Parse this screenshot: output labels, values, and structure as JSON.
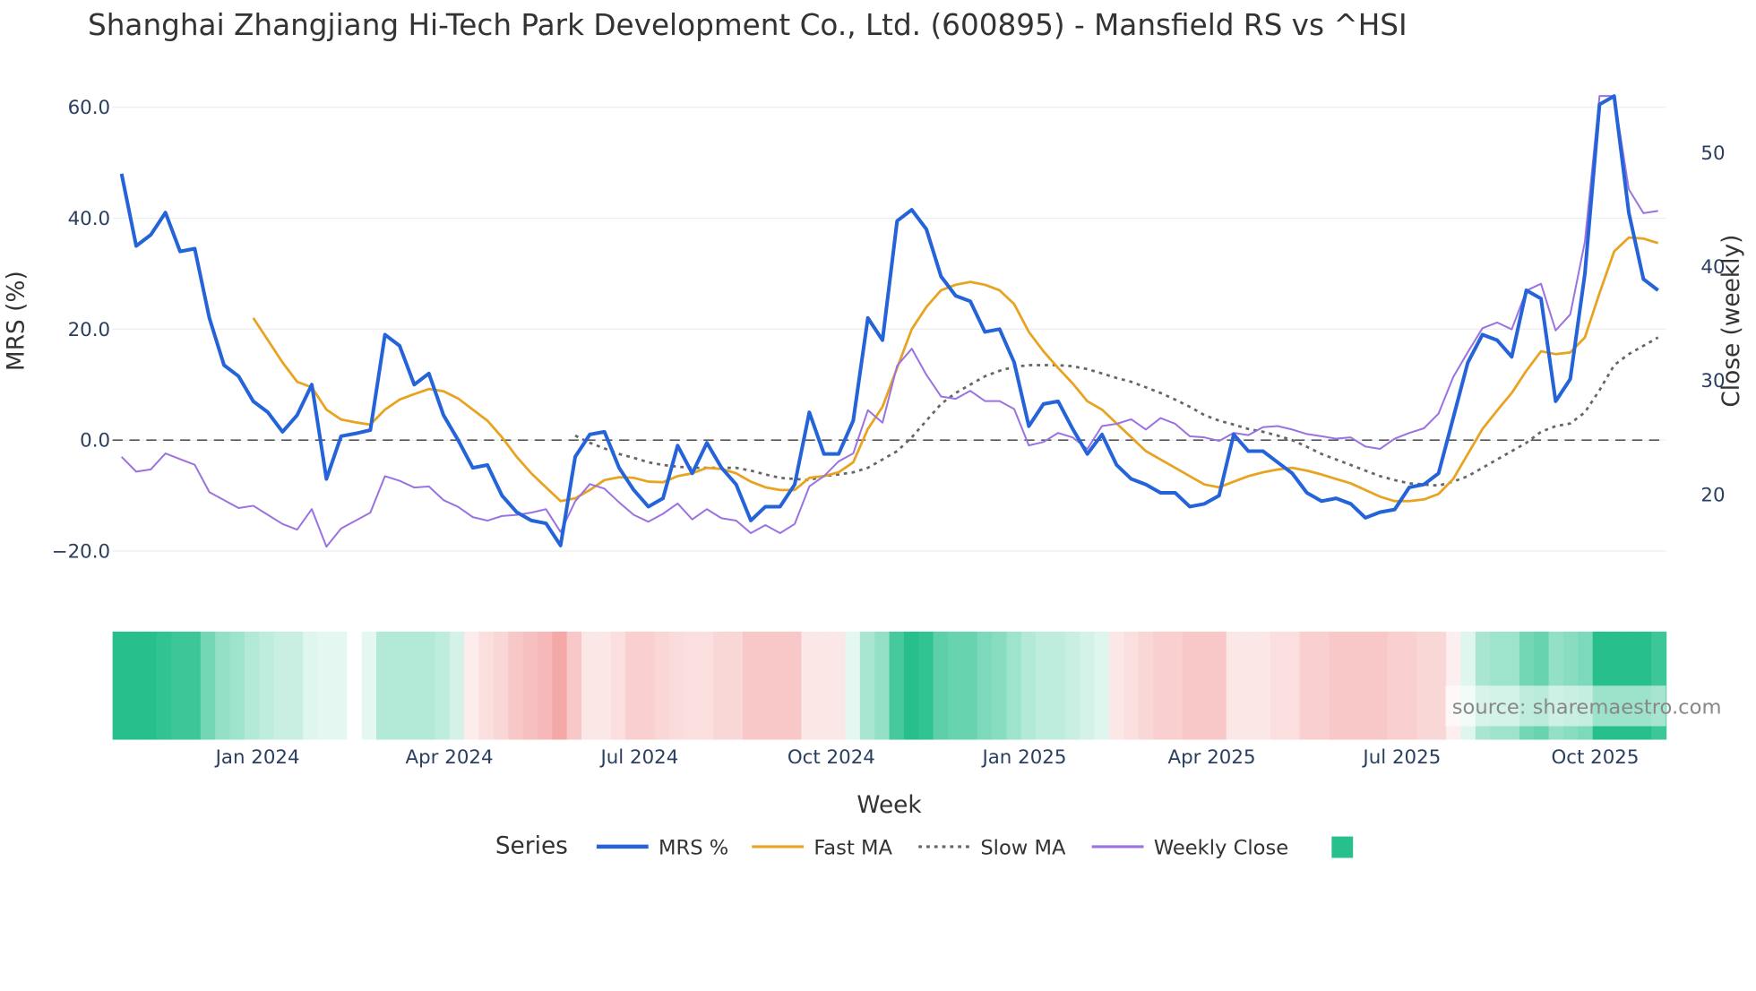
{
  "chart_data": {
    "type": "line",
    "title": "Shanghai Zhangjiang Hi-Tech Park Development Co., Ltd. (600895) - Mansfield RS vs ^HSI",
    "xlabel": "Week",
    "ylabel": "MRS (%)",
    "y2label": "Close (weekly)",
    "ylim": [
      -26.2,
      65.1
    ],
    "y2lim": [
      12.0,
      56.5
    ],
    "grid": true,
    "zero_line": 0,
    "yticks": [
      {
        "v": 60,
        "label": "60.0"
      },
      {
        "v": 40,
        "label": "40.0"
      },
      {
        "v": 20,
        "label": "20.0"
      },
      {
        "v": 0,
        "label": "0.0"
      },
      {
        "v": -20,
        "label": "−20.0"
      }
    ],
    "y2ticks": [
      {
        "v": 50,
        "label": "50"
      },
      {
        "v": 40,
        "label": "40"
      },
      {
        "v": 30,
        "label": "30"
      },
      {
        "v": 20,
        "label": "20"
      }
    ],
    "xticks": [
      {
        "week": 9.3,
        "label": "Jan 2024"
      },
      {
        "week": 22.4,
        "label": "Apr 2024"
      },
      {
        "week": 35.4,
        "label": "Jul 2024"
      },
      {
        "week": 48.5,
        "label": "Oct 2024"
      },
      {
        "week": 61.7,
        "label": "Jan 2025"
      },
      {
        "week": 74.5,
        "label": "Apr 2025"
      },
      {
        "week": 87.5,
        "label": "Jul 2025"
      },
      {
        "week": 100.7,
        "label": "Oct 2025"
      }
    ],
    "weeks": 106,
    "series": [
      {
        "name": "MRS %",
        "color": "#2563d9",
        "axis": "y",
        "values": [
          48,
          35,
          37,
          41,
          34,
          34.5,
          22,
          13.5,
          11.5,
          7,
          5,
          1.5,
          4.5,
          10,
          -7,
          0.7,
          1.2,
          1.8,
          19,
          17,
          10,
          12,
          4.5,
          0,
          -5,
          -4.5,
          -10,
          -13,
          -14.5,
          -15,
          -19,
          -3,
          1,
          1.5,
          -5,
          -9,
          -12,
          -10.5,
          -1,
          -6,
          -0.5,
          -5,
          -8,
          -14.5,
          -12,
          -12,
          -8,
          5,
          -2.5,
          -2.5,
          3.5,
          22,
          18,
          39.5,
          41.5,
          38,
          29.5,
          26,
          25,
          19.5,
          20,
          14,
          2.5,
          6.5,
          7,
          2,
          -2.5,
          1,
          -4.5,
          -7,
          -8,
          -9.5,
          -9.5,
          -12,
          -11.5,
          -10,
          1,
          -2,
          -2,
          -4,
          -6,
          -9.5,
          -11,
          -10.5,
          -11.5,
          -14,
          -13,
          -12.5,
          -8.5,
          -8,
          -6,
          4,
          14,
          19,
          18,
          15,
          27,
          25.5,
          7,
          11,
          30,
          60.5,
          62,
          41,
          29,
          27
        ]
      },
      {
        "name": "Fast MA",
        "color": "#e8a321",
        "axis": "y",
        "values": [
          22,
          18,
          14,
          10.5,
          9.5,
          5.5,
          3.7,
          3.2,
          2.8,
          5.5,
          7.3,
          8.3,
          9.2,
          8.8,
          7.5,
          5.5,
          3.5,
          0.5,
          -3,
          -6,
          -8.5,
          -11,
          -10.5,
          -9,
          -7.2,
          -6.7,
          -6.8,
          -7.5,
          -7.6,
          -6.5,
          -6,
          -5,
          -5.2,
          -6,
          -7.5,
          -8.5,
          -9,
          -9,
          -6.8,
          -6.5,
          -5.8,
          -4,
          2,
          6,
          13,
          20,
          24,
          27,
          28,
          28.5,
          28,
          27,
          24.5,
          19.5,
          16,
          13,
          10.2,
          7,
          5.5,
          3,
          0.5,
          -2,
          -3.5,
          -5,
          -6.5,
          -8,
          -8.5,
          -7.5,
          -6.5,
          -5.8,
          -5.3,
          -5,
          -5.5,
          -6.2,
          -7,
          -7.8,
          -9,
          -10.2,
          -11,
          -11,
          -10.7,
          -9.7,
          -7,
          -2.5,
          2,
          5.3,
          8.5,
          12.5,
          16,
          15.5,
          15.8,
          18.5,
          26.5,
          34,
          36.5,
          36.3,
          35.5
        ]
      },
      {
        "name": "Slow MA",
        "color": "#666666",
        "axis": "y",
        "dash": true,
        "values": [
          0.8,
          -0.5,
          -1.5,
          -2.5,
          -3.2,
          -4,
          -4.5,
          -4.8,
          -5,
          -5,
          -5,
          -5,
          -5.5,
          -6.2,
          -6.8,
          -7,
          -7.2,
          -6.5,
          -6.2,
          -5.8,
          -5,
          -3.5,
          -2,
          0.5,
          3.5,
          6.5,
          8.5,
          10,
          11.5,
          12.5,
          13.2,
          13.5,
          13.5,
          13.5,
          13.3,
          12.8,
          12,
          11.2,
          10.5,
          9.5,
          8.5,
          7.3,
          6,
          4.5,
          3.5,
          2.8,
          2,
          1.5,
          0.8,
          0,
          -1.2,
          -2.5,
          -3.5,
          -4.5,
          -5.5,
          -6.5,
          -7.2,
          -7.8,
          -8,
          -8.2,
          -7.5,
          -6.5,
          -5,
          -3.5,
          -2,
          -0.5,
          1.5,
          2.5,
          3,
          5,
          9,
          13.5,
          15.5,
          17,
          18.5
        ]
      },
      {
        "name": "Weekly Close",
        "color": "#9b72e0",
        "axis": "y2",
        "values": [
          23.3,
          22,
          22.2,
          23.6,
          23.1,
          22.6,
          20.2,
          19.5,
          18.8,
          19,
          18.2,
          17.4,
          16.9,
          18.7,
          15.4,
          17,
          17.7,
          18.4,
          21.6,
          21.2,
          20.6,
          20.7,
          19.5,
          18.9,
          18,
          17.7,
          18.1,
          18.2,
          18.4,
          18.7,
          16.7,
          19.4,
          20.9,
          20.5,
          19.3,
          18.2,
          17.6,
          18.3,
          19.2,
          17.8,
          18.7,
          17.9,
          17.7,
          16.6,
          17.3,
          16.6,
          17.4,
          20.7,
          21.6,
          22.9,
          23.6,
          27.4,
          26.3,
          31.3,
          32.8,
          30.5,
          28.6,
          28.4,
          29.1,
          28.2,
          28.2,
          27.5,
          24.3,
          24.6,
          25.4,
          25,
          24,
          26,
          26.2,
          26.6,
          25.7,
          26.7,
          26.2,
          25.1,
          25,
          24.7,
          25.4,
          25.2,
          25.9,
          26,
          25.7,
          25.3,
          25.1,
          24.9,
          25,
          24.2,
          24,
          24.9,
          25.4,
          25.8,
          27.1,
          30.3,
          32.5,
          34.6,
          35.1,
          34.5,
          37.9,
          38.5,
          34.4,
          35.8,
          42.2,
          55,
          55,
          46.8,
          44.7,
          44.9
        ]
      }
    ],
    "heatmap": {
      "positive_color": "#27c08d",
      "negative_color": "#f39c9c",
      "values": [
        1,
        1,
        1,
        0.95,
        0.9,
        0.9,
        0.65,
        0.5,
        0.45,
        0.35,
        0.3,
        0.25,
        0.25,
        0.15,
        0.12,
        0.12,
        null,
        0.12,
        0.35,
        0.35,
        0.35,
        0.35,
        0.3,
        0.2,
        -0.12,
        -0.2,
        -0.25,
        -0.35,
        -0.4,
        -0.45,
        -0.55,
        -0.35,
        -0.15,
        -0.15,
        -0.2,
        -0.3,
        -0.3,
        -0.25,
        -0.22,
        -0.2,
        -0.2,
        -0.25,
        -0.25,
        -0.35,
        -0.35,
        -0.35,
        -0.35,
        -0.15,
        -0.15,
        -0.15,
        0.12,
        0.4,
        0.5,
        0.85,
        1,
        0.95,
        0.75,
        0.7,
        0.7,
        0.6,
        0.55,
        0.45,
        0.35,
        0.3,
        0.3,
        0.25,
        0.2,
        0.15,
        -0.15,
        -0.2,
        -0.25,
        -0.3,
        -0.3,
        -0.35,
        -0.35,
        -0.35,
        -0.15,
        -0.15,
        -0.15,
        -0.2,
        -0.2,
        -0.3,
        -0.3,
        -0.35,
        -0.35,
        -0.35,
        -0.35,
        -0.3,
        -0.3,
        -0.25,
        -0.25,
        -0.1,
        0.15,
        0.4,
        0.45,
        0.45,
        0.65,
        0.7,
        0.5,
        0.55,
        0.6,
        1,
        1,
        1,
        1,
        0.9
      ]
    },
    "legend": {
      "title": "Series",
      "placement": "bottom",
      "items": [
        "MRS %",
        "Fast MA",
        "Slow MA",
        "Weekly Close"
      ]
    },
    "annotation": "source: sharemaestro.com"
  }
}
